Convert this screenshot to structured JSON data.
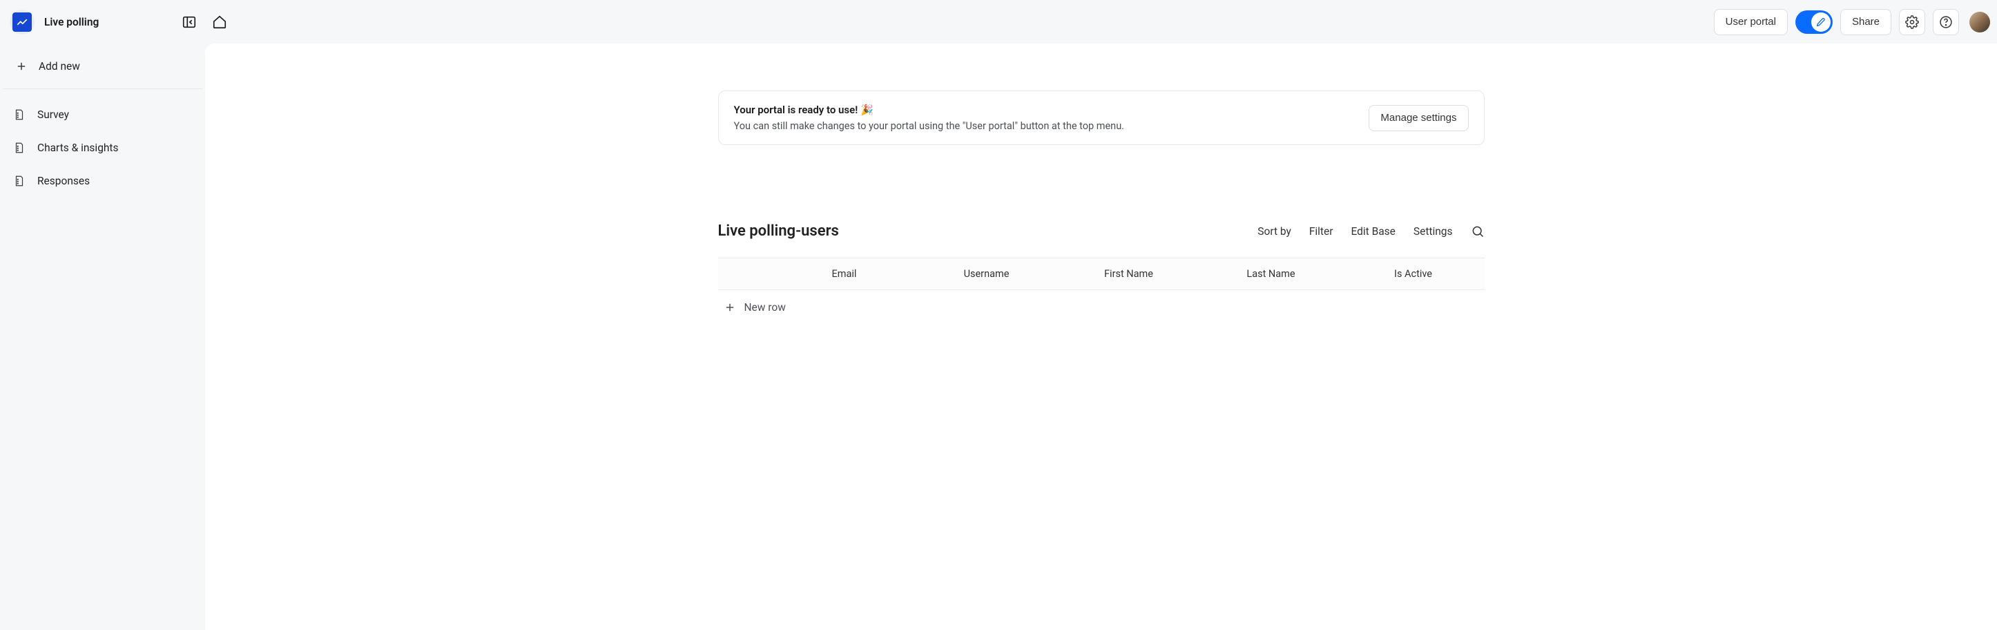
{
  "header": {
    "app_name": "Live polling",
    "user_portal_label": "User portal",
    "share_label": "Share"
  },
  "sidebar": {
    "add_new_label": "Add new",
    "items": [
      {
        "label": "Survey"
      },
      {
        "label": "Charts & insights"
      },
      {
        "label": "Responses"
      }
    ]
  },
  "banner": {
    "title": "Your portal is ready to use! 🎉",
    "description": "You can still make changes to your portal using the \"User portal\" button at the top menu.",
    "cta": "Manage settings"
  },
  "table": {
    "title": "Live polling-users",
    "actions": {
      "sort": "Sort by",
      "filter": "Filter",
      "edit_base": "Edit Base",
      "settings": "Settings"
    },
    "columns": [
      "Email",
      "Username",
      "First Name",
      "Last Name",
      "Is Active"
    ],
    "new_row_label": "New row"
  }
}
